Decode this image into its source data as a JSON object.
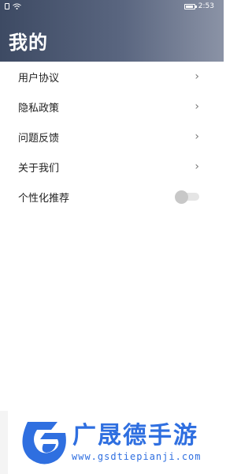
{
  "status_bar": {
    "time": "2:53"
  },
  "header": {
    "title": "我的"
  },
  "menu": {
    "items": [
      {
        "label": "用户协议",
        "chevron": "›"
      },
      {
        "label": "隐私政策",
        "chevron": "›"
      },
      {
        "label": "问题反馈",
        "chevron": "›"
      },
      {
        "label": "关于我们",
        "chevron": "›"
      }
    ],
    "toggle_item": {
      "label": "个性化推荐",
      "enabled": false
    }
  },
  "watermark": {
    "title": "广晟德手游",
    "url": "www.gsdtiepianji.com"
  },
  "colors": {
    "header_start": "#3d4a63",
    "header_end": "#8b93a6",
    "watermark": "#2f6fe0"
  }
}
